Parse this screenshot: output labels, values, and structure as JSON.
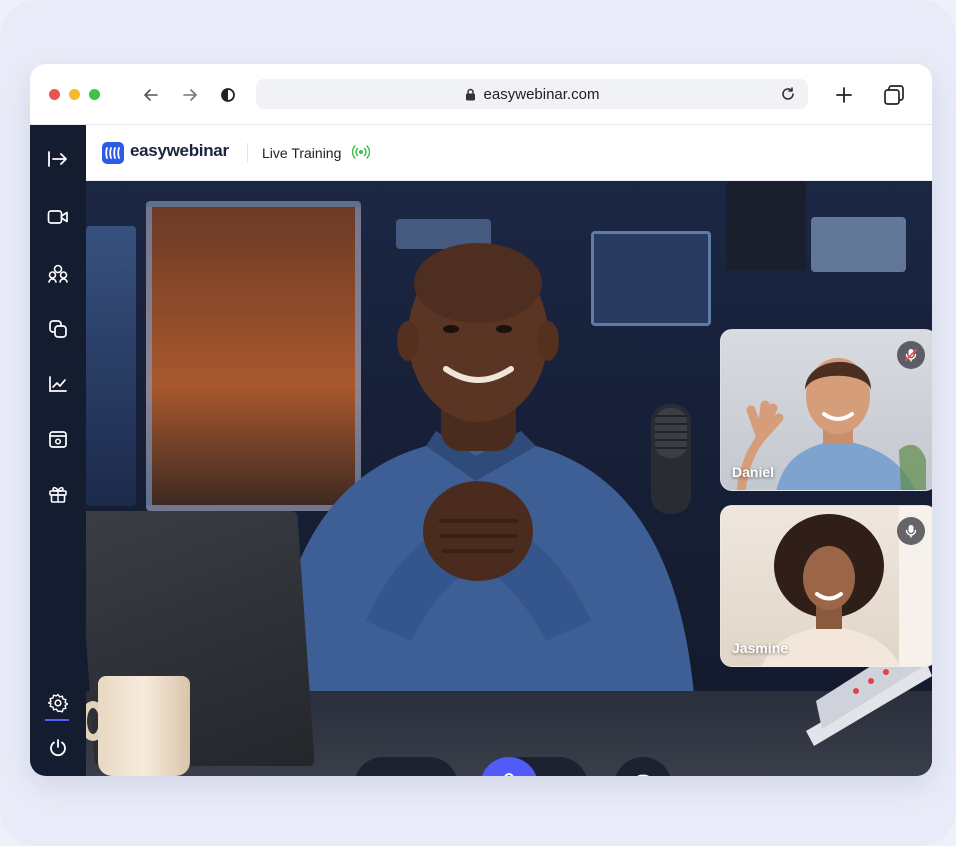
{
  "browser": {
    "url": "easywebinar.com"
  },
  "app": {
    "brand": "easywebinar",
    "session_title": "Live Training"
  },
  "sidebar": {
    "items": [
      {
        "icon": "sign-in-icon"
      },
      {
        "icon": "video-camera-icon"
      },
      {
        "icon": "people-group-icon"
      },
      {
        "icon": "duplicate-icon"
      },
      {
        "icon": "analytics-chart-icon"
      },
      {
        "icon": "calendar-icon"
      },
      {
        "icon": "gift-icon"
      }
    ],
    "bottom": [
      {
        "icon": "gear-icon"
      },
      {
        "icon": "power-icon"
      }
    ]
  },
  "participants": [
    {
      "name": "Daniel",
      "status_icon": "mic-muted-icon"
    },
    {
      "name": "Jasmine",
      "status_icon": "mic-icon"
    }
  ],
  "controls": {
    "camera_icon": "video-camera-icon",
    "mic_icon": "mic-icon",
    "chat_icon": "chat-bubble-icon",
    "accent": "#4f5cf5"
  }
}
